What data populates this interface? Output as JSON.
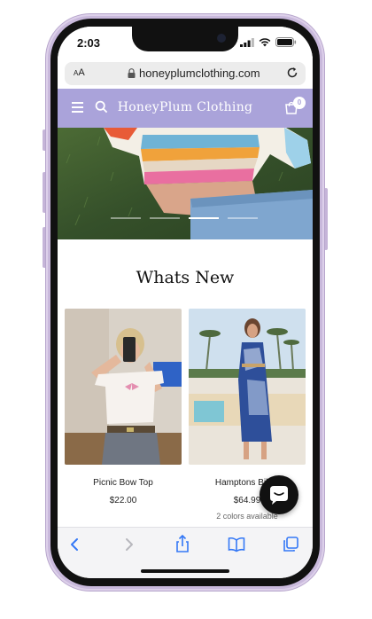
{
  "status_bar": {
    "time": "2:03"
  },
  "browser": {
    "text_size_label_small": "A",
    "text_size_label_large": "A",
    "url": "honeyplumclothing.com"
  },
  "site": {
    "brand": "HoneyPlum Clothing",
    "cart_count": "0",
    "header_color": "#aaa3da"
  },
  "hero": {
    "slides": 4,
    "active_slide_index": 3
  },
  "section": {
    "title": "Whats New"
  },
  "products": [
    {
      "name": "Picnic Bow Top",
      "price": "$22.00",
      "colors": ""
    },
    {
      "name": "Hamptons Bikini",
      "price": "$64.99",
      "colors": "2 colors available"
    }
  ]
}
